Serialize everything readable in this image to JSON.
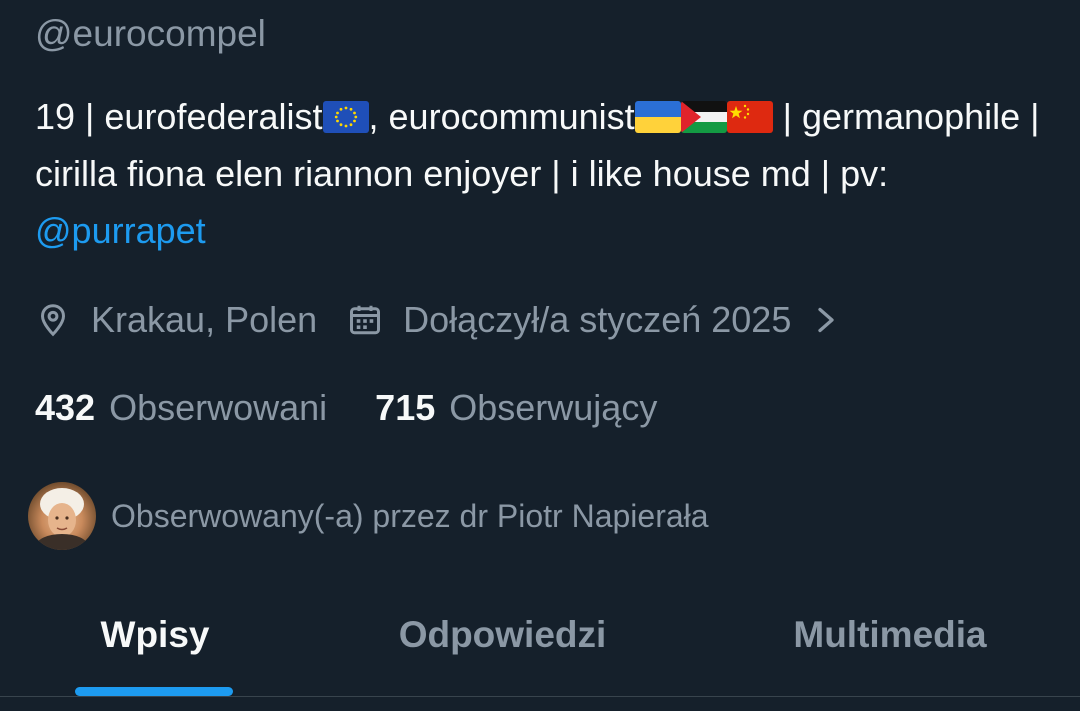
{
  "profile": {
    "handle": "@eurocompel",
    "bio": {
      "part1": "19 | eurofederalist",
      "part2": ", eurocommunist",
      "part3": " | germanophile | cirilla fiona elen riannon enjoyer | i like house md | pv: ",
      "mention": "@purrapet",
      "flags": [
        "flag-eu-icon",
        "flag-ukraine-icon",
        "flag-palestine-icon",
        "flag-china-icon"
      ]
    },
    "location": "Krakau, Polen",
    "joined": "Dołączył/a styczeń 2025",
    "following_count": "432",
    "following_label": "Obserwowani",
    "followers_count": "715",
    "followers_label": "Obserwujący",
    "followed_by": "Obserwowany(-a) przez dr Piotr Napierała"
  },
  "tabs": [
    {
      "label": "Wpisy",
      "active": true
    },
    {
      "label": "Odpowiedzi",
      "active": false
    },
    {
      "label": "Multimedia",
      "active": false
    }
  ],
  "colors": {
    "background": "#15202b",
    "primary_text": "#f7f9f9",
    "secondary_text": "#8b98a5",
    "accent": "#1d9bf0"
  }
}
